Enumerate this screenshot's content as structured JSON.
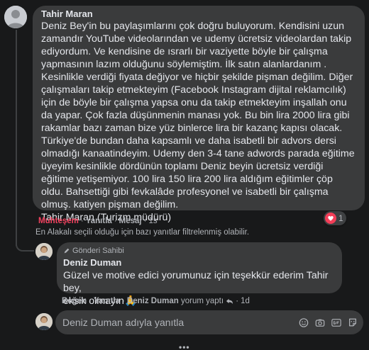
{
  "comment": {
    "author": "Tahir Maran",
    "text": "Deniz Bey'in bu paylaşımlarını çok doğru buluyorum. Kendisini uzun\nzamandır YouTube videolarından ve udemy ücretsiz videolardan takip\nediyordum. Ve kendisine de ısrarlı bir vaziyette böyle bir çalışma\nyapmasının lazım olduğunu söylemiştim. İlk satın alanlardanım .\nKesinlikle verdiği fiyata değiyor ve hiçbir şekilde pişman değilim. Diğer\nçalışmaları takip etmekteyim (Facebook Instagram dijital reklamcılık)\niçin de böyle bir çalışma yapsa onu da takip etmekteyim inşallah onu\nda yapar. Çok fazla düşünmenin manası yok. Bu bin lira 2000 lira gibi\nrakamlar bazı zaman bize yüz binlerce lira bir kazanç kapısı olacak.\nTürkiye'de bundan daha kapsamlı ve daha isabetli bir advors dersi\nolmadığı kanaatindeyim. Udemy den 3-4 tane adwords parada eğitime\nüyeyim kesinlikle dördünün toplamı Deniz beyin ücretsiz verdiği\neğitime yetişemiyor. 100 lira 150 lira 200 lira aldığım eğitimler çöp\noldu. Bahsettiği gibi fevkalâde profesyonel ve isabetli bir çalışma\nolmuş. katiyen pişman değilim.\nTahir Maran (Turizm müdürü)",
    "reaction_label": "Muhteşem",
    "reply_label": "Yanıtla",
    "message_label": "Mesaj",
    "time": "1s",
    "reaction_count": "1"
  },
  "filter_note": "En Alakalı seçili olduğu için bazı yanıtlar filtrelenmiş olabilir.",
  "reply": {
    "badge": "Gönderi Sahibi",
    "author": "Deniz Duman",
    "text": "Güzel ve motive edici yorumunuz için teşekkür ederim Tahir bey,\neksik olmayın🙏",
    "like_label": "Beğen",
    "reply_label": "Yanıtla",
    "replied_by": "Deniz Duman",
    "replied_suffix": "yorum yaptı",
    "time": "1d"
  },
  "reply_box": {
    "placeholder": "Deniz Duman adıyla yanıtla",
    "icons": [
      "emoji-icon",
      "camera-icon",
      "gif-icon",
      "sticker-icon"
    ]
  },
  "colors": {
    "background": "#18191a",
    "bubble": "#3a3b3c",
    "secondary_text": "#b0b3b8",
    "love_reaction": "#f33e58"
  }
}
